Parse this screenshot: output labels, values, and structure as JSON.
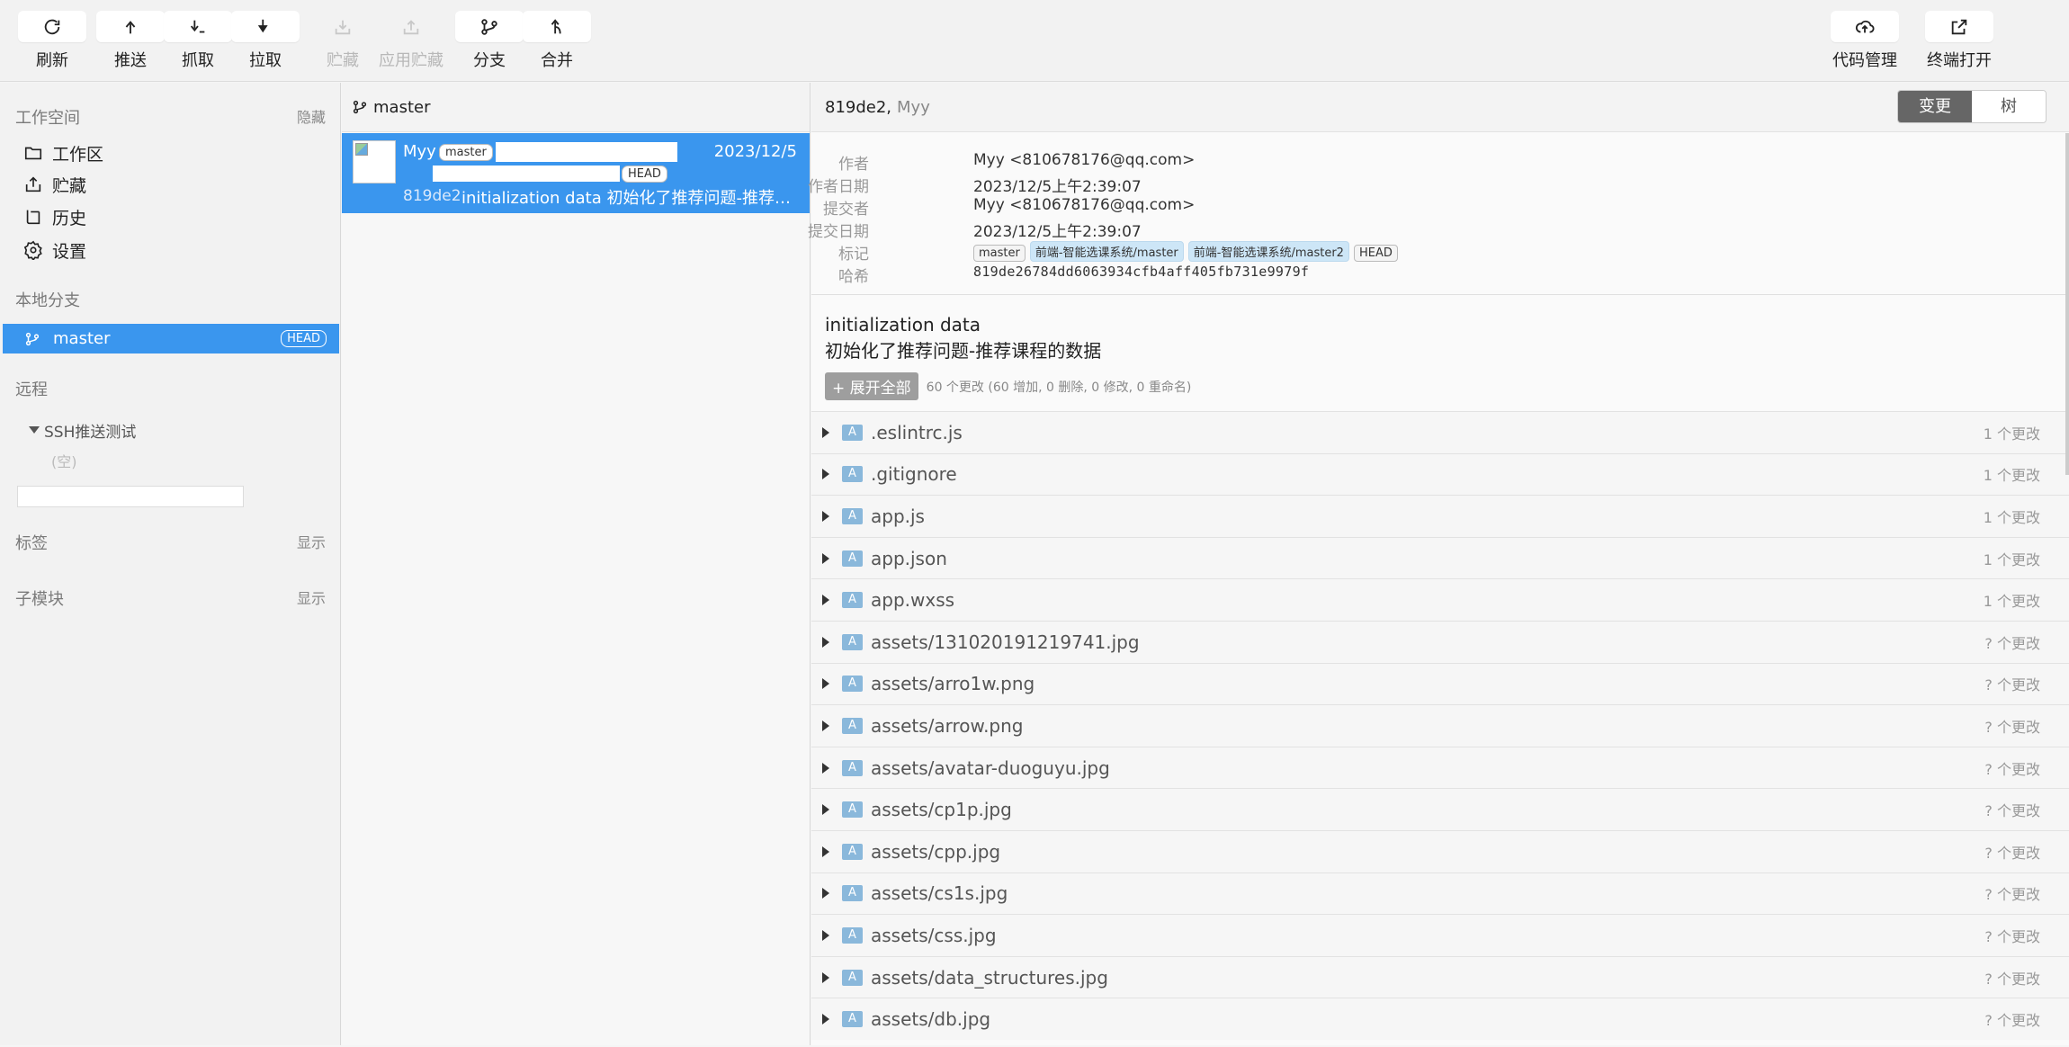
{
  "toolbar": {
    "refresh": "刷新",
    "push": "推送",
    "fetch": "抓取",
    "pull": "拉取",
    "stash": "贮藏",
    "apply_stash": "应用贮藏",
    "branch": "分支",
    "merge": "合并",
    "code_manage": "代码管理",
    "terminal": "终端打开"
  },
  "sidebar": {
    "workspace_title": "工作空间",
    "workspace_action": "隐藏",
    "items": [
      {
        "label": "工作区",
        "icon": "folder-icon"
      },
      {
        "label": "贮藏",
        "icon": "stash-icon"
      },
      {
        "label": "历史",
        "icon": "history-icon"
      },
      {
        "label": "设置",
        "icon": "gear-icon"
      }
    ],
    "local_branch_title": "本地分支",
    "current_branch": "master",
    "head_badge": "HEAD",
    "remote_title": "远程",
    "remote_name": "SSH推送测试",
    "remote_empty": "(空)",
    "tags_title": "标签",
    "tags_action": "显示",
    "submodules_title": "子模块",
    "submodules_action": "显示"
  },
  "commit_list": {
    "branch": "master",
    "commit": {
      "author": "Myy",
      "tag_master": "master",
      "tag_head": "HEAD",
      "date": "2023/12/5",
      "hash": "819de2",
      "message": "initialization data 初始化了推荐问题-推荐课程的数据"
    }
  },
  "detail": {
    "hash_short": "819de2,",
    "author_short": "Myy",
    "view_tabs": {
      "changes": "变更",
      "tree": "树"
    },
    "meta": {
      "author_label": "作者",
      "author": "Myy <810678176@qq.com>",
      "author_date_label": "作者日期",
      "author_date": "2023/12/5上午2:39:07",
      "committer_label": "提交者",
      "committer": "Myy <810678176@qq.com>",
      "commit_date_label": "提交日期",
      "commit_date": "2023/12/5上午2:39:07",
      "refs_label": "标记",
      "refs": [
        "master",
        "前端-智能选课系统/master",
        "前端-智能选课系统/master2",
        "HEAD"
      ],
      "hash_label": "哈希",
      "hash": "819de26784dd6063934cfb4aff405fb731e9979f"
    },
    "message_line1": "initialization data",
    "message_line2": "初始化了推荐问题-推荐课程的数据",
    "expand_label": "+ 展开全部",
    "change_summary": "60 个更改 (60 增加, 0 删除, 0 修改, 0 重命名)",
    "files": [
      {
        "status": "A",
        "name": ".eslintrc.js",
        "count": "1 个更改"
      },
      {
        "status": "A",
        "name": ".gitignore",
        "count": "1 个更改"
      },
      {
        "status": "A",
        "name": "app.js",
        "count": "1 个更改"
      },
      {
        "status": "A",
        "name": "app.json",
        "count": "1 个更改"
      },
      {
        "status": "A",
        "name": "app.wxss",
        "count": "1 个更改"
      },
      {
        "status": "A",
        "name": "assets/131020191219741.jpg",
        "count": "? 个更改"
      },
      {
        "status": "A",
        "name": "assets/arro1w.png",
        "count": "? 个更改"
      },
      {
        "status": "A",
        "name": "assets/arrow.png",
        "count": "? 个更改"
      },
      {
        "status": "A",
        "name": "assets/avatar-duoguyu.jpg",
        "count": "? 个更改"
      },
      {
        "status": "A",
        "name": "assets/cp1p.jpg",
        "count": "? 个更改"
      },
      {
        "status": "A",
        "name": "assets/cpp.jpg",
        "count": "? 个更改"
      },
      {
        "status": "A",
        "name": "assets/cs1s.jpg",
        "count": "? 个更改"
      },
      {
        "status": "A",
        "name": "assets/css.jpg",
        "count": "? 个更改"
      },
      {
        "status": "A",
        "name": "assets/data_structures.jpg",
        "count": "? 个更改"
      },
      {
        "status": "A",
        "name": "assets/db.jpg",
        "count": "? 个更改"
      }
    ]
  }
}
